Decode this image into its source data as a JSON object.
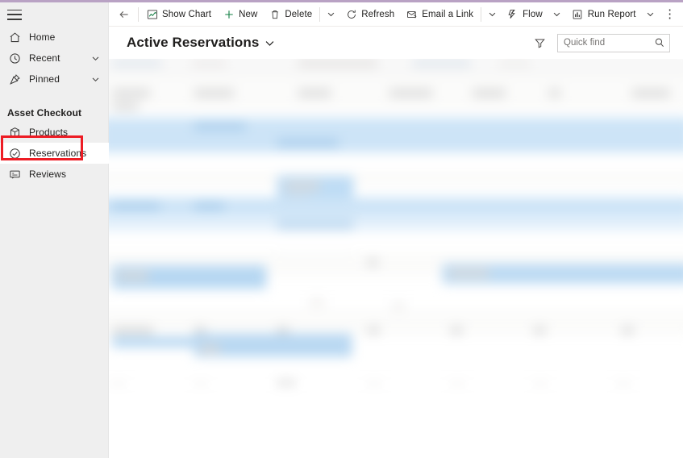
{
  "window": {
    "accent_color": "#b9a2c4",
    "background": "#ffffff"
  },
  "sidebar": {
    "menu_button": "hamburger-menu",
    "items": [
      {
        "label": "Home",
        "icon": "home-icon",
        "has_chevron": false,
        "selected": false
      },
      {
        "label": "Recent",
        "icon": "clock-icon",
        "has_chevron": true,
        "selected": false
      },
      {
        "label": "Pinned",
        "icon": "pin-icon",
        "has_chevron": true,
        "selected": false
      }
    ],
    "section_title": "Asset Checkout",
    "area_items": [
      {
        "label": "Products",
        "icon": "box-icon",
        "selected": false
      },
      {
        "label": "Reservations",
        "icon": "check-circle-icon",
        "selected": true
      },
      {
        "label": "Reviews",
        "icon": "comment-icon",
        "selected": false
      }
    ],
    "annotation": {
      "target": "Reservations",
      "color": "#ed1c24"
    }
  },
  "command_bar": {
    "back_label": "back-arrow",
    "commands": [
      {
        "label": "Show Chart",
        "icon": "chart-icon",
        "caret": false
      },
      {
        "label": "New",
        "icon": "plus-icon",
        "caret": false
      },
      {
        "label": "Delete",
        "icon": "trash-icon",
        "caret": true
      },
      {
        "label": "Refresh",
        "icon": "refresh-icon",
        "caret": false
      },
      {
        "label": "Email a Link",
        "icon": "email-icon",
        "caret": true
      },
      {
        "label": "Flow",
        "icon": "flow-icon",
        "caret": true
      },
      {
        "label": "Run Report",
        "icon": "report-icon",
        "caret": true
      }
    ],
    "overflow_label": "⋮"
  },
  "view": {
    "title": "Active Reservations",
    "title_caret": "chevron-down-icon",
    "filter_icon": "filter-icon",
    "search": {
      "placeholder": "Quick find",
      "value": "",
      "icon": "search-icon"
    }
  },
  "grid": {
    "state": "blurred",
    "note": "Record list content is visually obscured (blurred) in the screenshot.",
    "selection_color": "#cde4f7"
  }
}
